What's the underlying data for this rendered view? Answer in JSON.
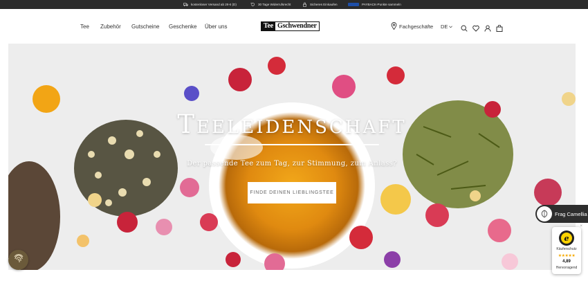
{
  "topbar": {
    "items": [
      {
        "icon": "truck-icon",
        "label": "kostenloser Versand ab 29 € (D)"
      },
      {
        "icon": "return-icon",
        "label": "30 Tage Widerrufsrecht"
      },
      {
        "icon": "lock-icon",
        "label": "Sicheres Einkaufen"
      },
      {
        "icon": "payback-logo",
        "label": "PAYBACK-Punkte sammeln"
      }
    ]
  },
  "nav": {
    "items": [
      "Tee",
      "Zubehör",
      "Gutscheine",
      "Geschenke",
      "Über uns"
    ]
  },
  "logo": {
    "part1": "Tee",
    "part2": "Gschwendner"
  },
  "header": {
    "store_link": "Fachgeschäfte",
    "language": "DE",
    "icons": [
      "search-icon",
      "heart-icon",
      "user-icon",
      "bag-icon"
    ]
  },
  "hero": {
    "title": "Teeleidenschaft",
    "subtitle": "Der passende Tee zum Tag, zur Stimmung, zum Anlass?",
    "cta": "FINDE DEINEN LIEBLINGSTEE"
  },
  "chat": {
    "label": "Frag Camellia"
  },
  "trust_badge": {
    "seal": "e",
    "label": "Käuferschutz",
    "stars": "★★★★★",
    "score": "4,89",
    "rating": "Hervorragend"
  },
  "colors": {
    "topbar_bg": "#2b2b2b",
    "hero_bg": "#ededed",
    "chat_bg": "#2e2e2e",
    "cookie_bg": "#6b5a3a",
    "star": "#f6a800"
  }
}
